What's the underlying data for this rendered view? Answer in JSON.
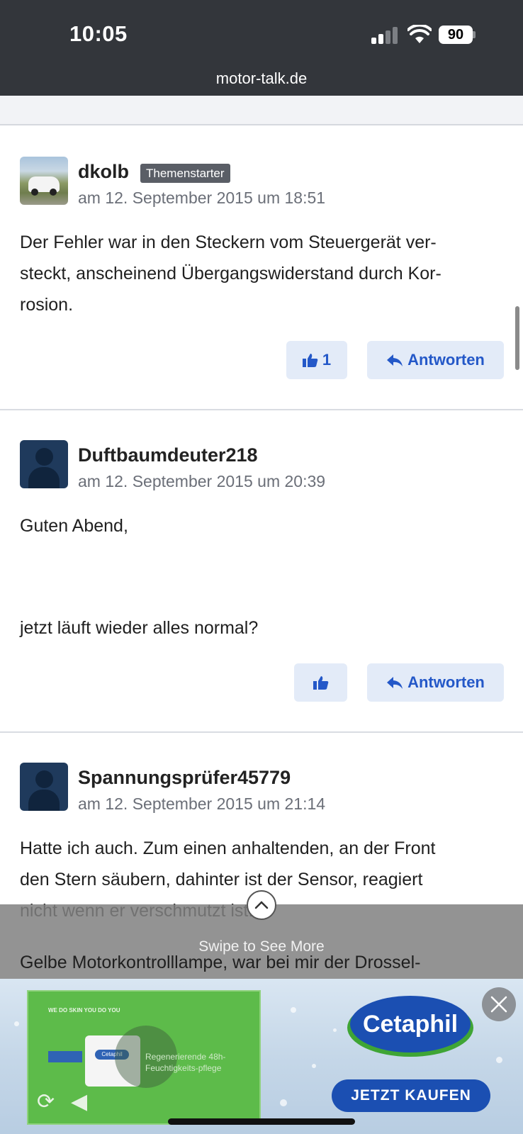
{
  "status_bar": {
    "time": "10:05",
    "battery": "90",
    "signal_icon": "cellular-signal-icon",
    "wifi_icon": "wifi-icon"
  },
  "browser": {
    "url": "motor-talk.de"
  },
  "posts": [
    {
      "username": "dkolb",
      "badge": "Themenstarter",
      "date": "am 12. September 2015 um 18:51",
      "text": [
        "Der Fehler war in den Steckern vom Steuergerät ver-",
        "steckt, anscheinend Übergangswiderstand durch Kor-",
        "rosion."
      ],
      "likes": "1",
      "reply_label": "Antworten"
    },
    {
      "username": "Duftbaumdeuter218",
      "date": "am 12. September 2015 um 20:39",
      "text": [
        "Guten Abend,",
        "jetzt läuft wieder alles normal?"
      ],
      "reply_label": "Antworten"
    },
    {
      "username": "Spannungsprüfer45779",
      "date": "am 12. September 2015 um 21:14",
      "text": [
        "Hatte ich auch. Zum einen anhaltenden, an der Front",
        "den Stern säubern, dahinter ist der Sensor, reagiert",
        "nicht wenn er verschmutzt ist.",
        "Gelbe Motorkontrolllampe, war bei mir der Drossel-"
      ]
    }
  ],
  "ad": {
    "swipe_hint": "Swipe to See More",
    "brand": "Cetaphil",
    "cta": "JETZT KAUFEN",
    "video_tagline": "WE DO SKIN\nYOU DO YOU",
    "video_product_text": "Regenerierende 48h-Feuchtigkeits-pflege",
    "jar_label": "Cetaphil"
  },
  "colors": {
    "accent": "#2458c8",
    "button_bg": "#e3ebf8",
    "topbar": "#33363b",
    "brand_blue": "#1b4fb2",
    "brand_green": "#3fa535"
  }
}
